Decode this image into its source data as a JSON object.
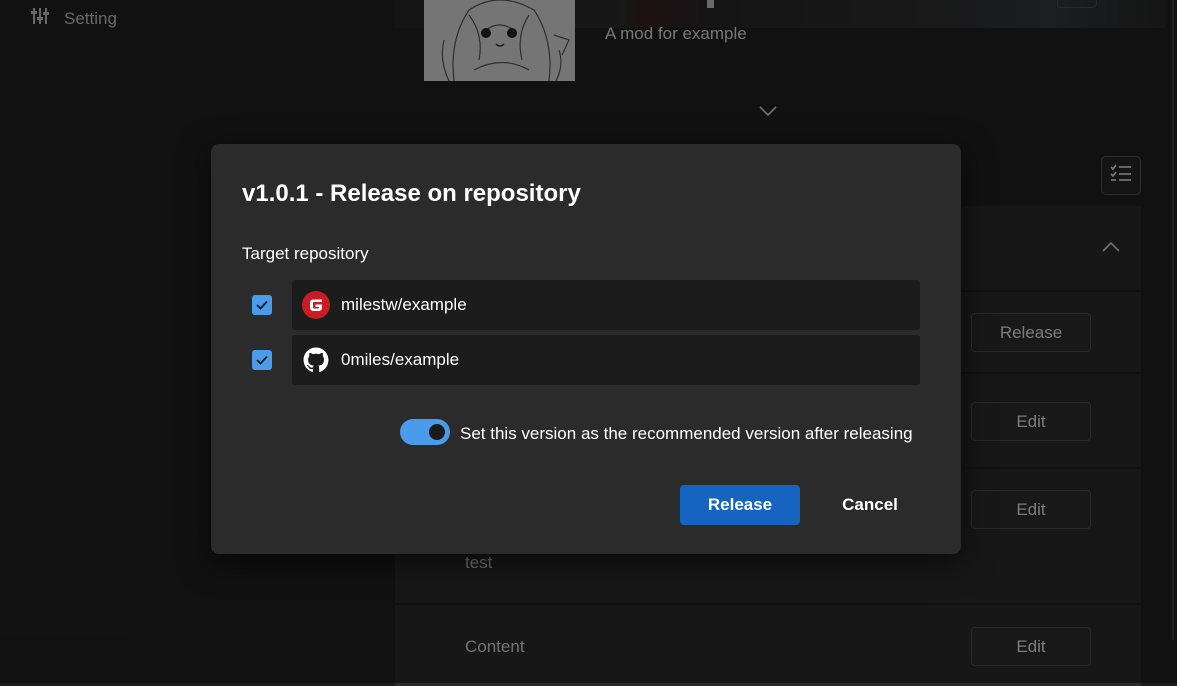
{
  "sidebar": {
    "setting_label": "Setting"
  },
  "mod": {
    "description": "A mod for example"
  },
  "background_rows": {
    "release_button": "Release",
    "edit_button_1": "Edit",
    "edit_button_2": "Edit",
    "test_text": "test",
    "content_label": "Content",
    "edit_button_3": "Edit"
  },
  "dialog": {
    "title": "v1.0.1 - Release on repository",
    "target_label": "Target repository",
    "repositories": [
      {
        "name": "milestw/example",
        "icon": "gitee-icon",
        "checked": true
      },
      {
        "name": "0miles/example",
        "icon": "github-icon",
        "checked": true
      }
    ],
    "recommended_toggle": {
      "label": "Set this version as the recommended version after releasing",
      "on": true
    },
    "release_label": "Release",
    "cancel_label": "Cancel"
  },
  "colors": {
    "accent": "#4a9bea",
    "primary_button": "#1565c0",
    "dialog_bg": "#2b2b2b",
    "gitee_red": "#c71d23"
  }
}
